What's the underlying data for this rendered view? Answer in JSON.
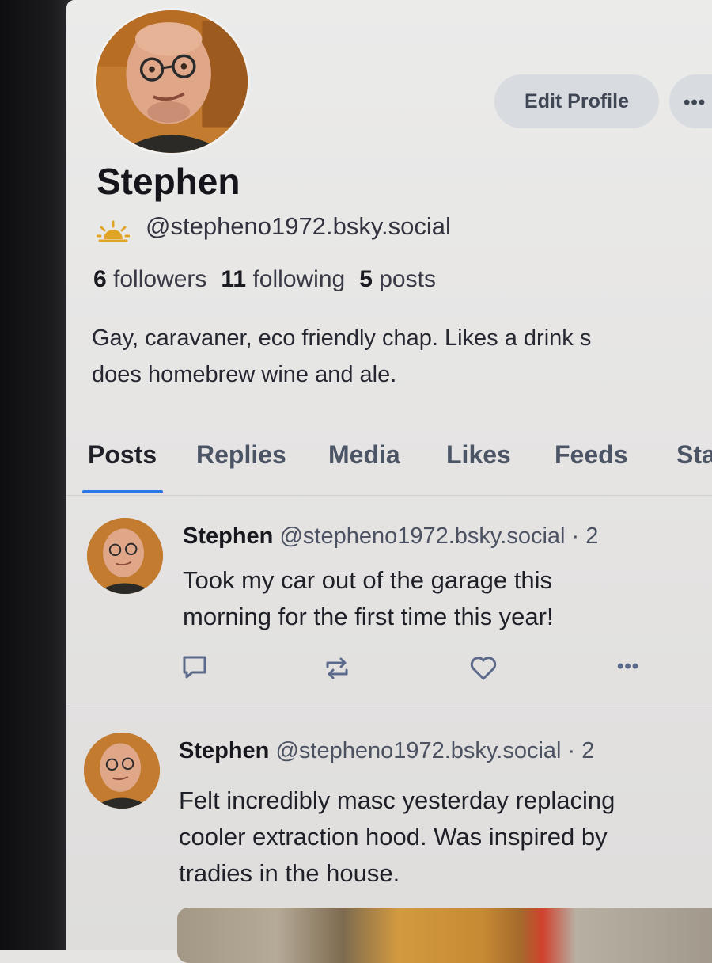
{
  "profile": {
    "display_name": "Stephen",
    "handle": "@stepheno1972.bsky.social",
    "followers_count": "6",
    "followers_label": "followers",
    "following_count": "11",
    "following_label": "following",
    "posts_count": "5",
    "posts_label": "posts",
    "bio_line1": "Gay, caravaner, eco friendly chap. Likes a drink s",
    "bio_line2": "does homebrew wine and ale."
  },
  "actions": {
    "edit_profile": "Edit Profile",
    "more": "•••"
  },
  "tabs": [
    {
      "label": "Posts",
      "active": true
    },
    {
      "label": "Replies"
    },
    {
      "label": "Media"
    },
    {
      "label": "Likes"
    },
    {
      "label": "Feeds"
    },
    {
      "label": "Sta"
    }
  ],
  "posts": [
    {
      "author": "Stephen",
      "handle": "@stepheno1972.bsky.social · 2",
      "text_line1": "Took my car out of the garage this",
      "text_line2": "morning for the first time this year!",
      "text_line3": "",
      "icons": [
        "reply-icon",
        "repost-icon",
        "like-icon",
        "more-icon"
      ]
    },
    {
      "author": "Stephen",
      "handle": "@stepheno1972.bsky.social · 2",
      "text_line1": "Felt incredibly masc yesterday replacing",
      "text_line2": "cooler extraction hood. Was inspired by",
      "text_line3": "tradies in the house."
    }
  ],
  "colors": {
    "accent_tab_underline": "#2a78e5",
    "button_bg": "#d8dbe0",
    "icon_color": "#5b6a8a",
    "sun_icon": "#e0a526"
  }
}
